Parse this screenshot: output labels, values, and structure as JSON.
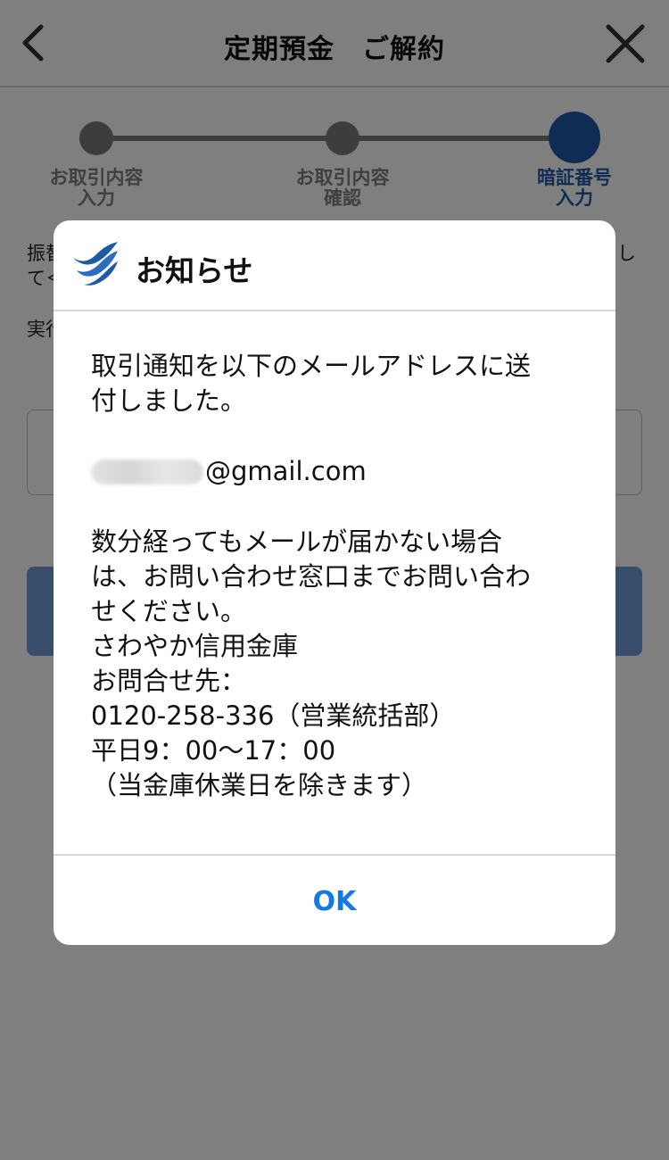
{
  "header": {
    "title": "定期預金　ご解約",
    "back_icon": "chevron-left-icon",
    "close_icon": "close-icon"
  },
  "stepper": {
    "steps": [
      {
        "line1": "お取引内容",
        "line2": "入力"
      },
      {
        "line1": "お取引内容",
        "line2": "確認"
      },
      {
        "line1": "暗証番号",
        "line2": "入力"
      }
    ],
    "active_color": "#1e5aa8",
    "inactive_color": "#7a7a7a"
  },
  "background_page": {
    "text_line1_fragment": "振替",
    "text_line1_tail": "し",
    "text_line2_fragment": "て＜",
    "text_line3_fragment": "実行"
  },
  "dialog": {
    "title": "お知らせ",
    "logo_icon": "bank-logo-icon",
    "message_line1": "取引通知を以下のメールアドレスに送",
    "message_line2": "付しました。",
    "email_domain": "@gmail.com",
    "notice_line1": "数分経ってもメールが届かない場合",
    "notice_line2": "は、お問い合わせ窓口までお問い合わ",
    "notice_line3": "せください。",
    "bank_name": "さわやか信用金庫",
    "contact_label": "お問合せ先：",
    "phone": "0120-258-336（営業統括部）",
    "hours": "平日9：00～17：00",
    "holiday_note": "（当金庫休業日を除きます）",
    "ok_label": "OK",
    "accent_color": "#1478e6"
  }
}
